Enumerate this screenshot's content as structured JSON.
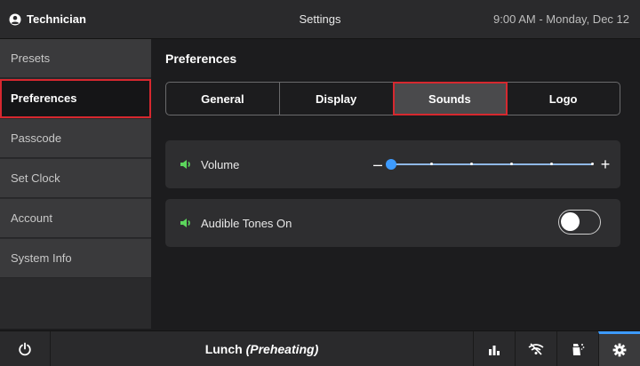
{
  "header": {
    "user": "Technician",
    "title": "Settings",
    "clock": "9:00 AM - Monday, Dec 12"
  },
  "sidebar": {
    "items": [
      {
        "label": "Presets"
      },
      {
        "label": "Preferences",
        "active": true
      },
      {
        "label": "Passcode"
      },
      {
        "label": "Set Clock"
      },
      {
        "label": "Account"
      },
      {
        "label": "System Info"
      }
    ]
  },
  "main": {
    "section_title": "Preferences",
    "tabs": [
      {
        "label": "General"
      },
      {
        "label": "Display"
      },
      {
        "label": "Sounds",
        "active": true
      },
      {
        "label": "Logo"
      }
    ],
    "volume": {
      "label": "Volume",
      "minus": "–",
      "plus": "+",
      "level_fraction": 0.0,
      "steps": 6
    },
    "tones": {
      "label": "Audible Tones On",
      "enabled": false
    }
  },
  "footer": {
    "status_main": "Lunch",
    "status_paren": "(Preheating)"
  },
  "colors": {
    "accent": "#3d9bff",
    "highlight": "#d6282f"
  }
}
